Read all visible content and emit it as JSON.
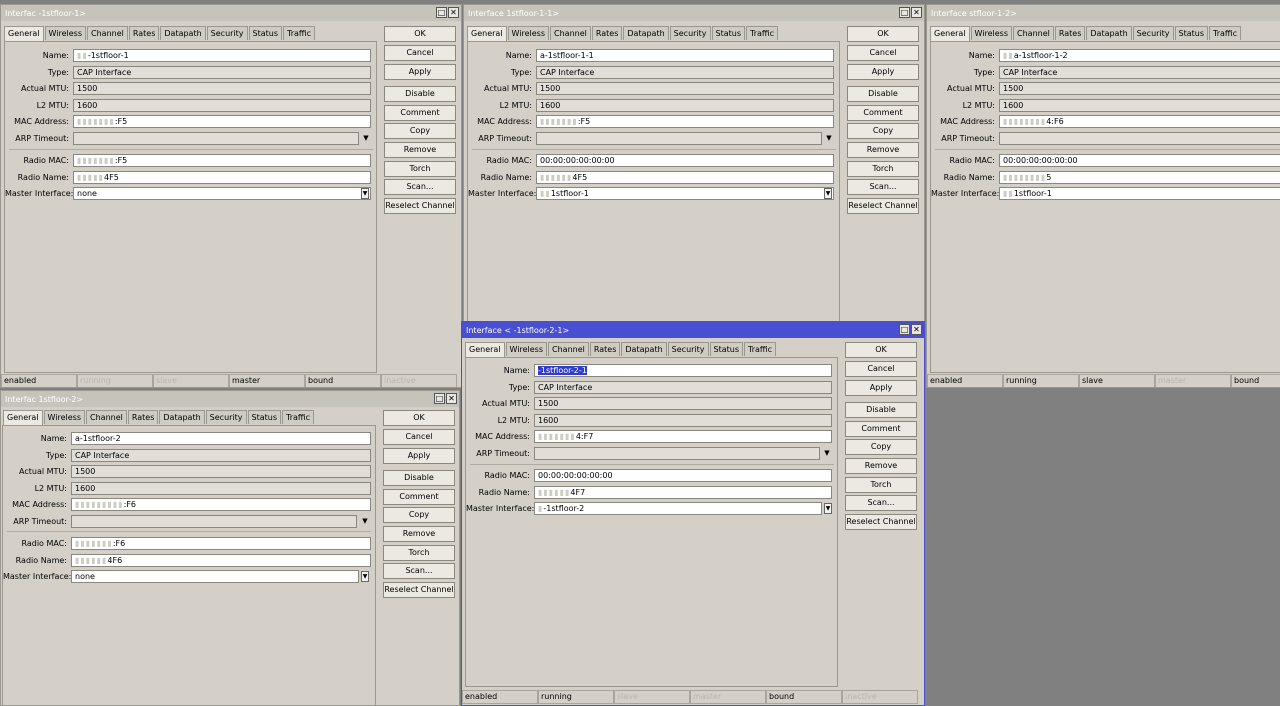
{
  "tabs": [
    "General",
    "Wireless",
    "Channel",
    "Rates",
    "Datapath",
    "Security",
    "Status",
    "Traffic"
  ],
  "buttons": [
    "OK",
    "Cancel",
    "Apply",
    "Disable",
    "Comment",
    "Copy",
    "Remove",
    "Torch",
    "Scan...",
    "Reselect Channel"
  ],
  "status_cells": [
    "enabled",
    "running",
    "slave",
    "master",
    "bound",
    "inactive"
  ],
  "windows": {
    "w1": {
      "title": "Interfac      -1stfloor-1>",
      "labels": [
        "Name:",
        "Type:",
        "Actual MTU:",
        "L2 MTU:",
        "MAC Address:",
        "ARP Timeout:",
        "Radio MAC:",
        "Radio Name:",
        "Master Interface:"
      ],
      "name": "-1stfloor-1",
      "type": "CAP Interface",
      "actual_mtu": "1500",
      "l2_mtu": "1600",
      "mac": ":F5",
      "arp_timeout": "",
      "radio_mac": ":F5",
      "radio_name": "4F5",
      "master": "none"
    },
    "w2": {
      "title": "Interface      1stfloor-1-1>",
      "labels": [
        "Name:",
        "Type:",
        "Actual MTU:",
        "L2 MTU:",
        "MAC Address:",
        "ARP Timeout:",
        "Radio MAC:",
        "Radio Name:",
        "Master Interface:"
      ],
      "name": "a-1stfloor-1-1",
      "type": "CAP Interface",
      "actual_mtu": "1500",
      "l2_mtu": "1600",
      "mac": ":F5",
      "arp_timeout": "",
      "radio_mac": "00:00:00:00:00:00",
      "radio_name": "4F5",
      "master": "1stfloor-1"
    },
    "w3": {
      "title": "Interface      stfloor-1-2>",
      "labels": [
        "Name:",
        "Type:",
        "Actual MTU:",
        "L2 MTU:",
        "MAC Address:",
        "ARP Timeout:",
        "Radio MAC:",
        "Radio Name:",
        "Master Interface:"
      ],
      "name": "a-1stfloor-1-2",
      "type": "CAP Interface",
      "actual_mtu": "1500",
      "l2_mtu": "1600",
      "mac": "4:F6",
      "arp_timeout": "",
      "radio_mac": "00:00:00:00:00:00",
      "radio_name": "5",
      "master": "1stfloor-1"
    },
    "w4": {
      "title": "Interface <      -1stfloor-2-1>",
      "labels": [
        "Name:",
        "Type:",
        "Actual MTU:",
        "L2 MTU:",
        "MAC Address:",
        "ARP Timeout:",
        "Radio MAC:",
        "Radio Name:",
        "Master Interface:"
      ],
      "name": "-1stfloor-2-1",
      "type": "CAP Interface",
      "actual_mtu": "1500",
      "l2_mtu": "1600",
      "mac": "4:F7",
      "arp_timeout": "",
      "radio_mac": "00:00:00:00:00:00",
      "radio_name": "4F7",
      "master": "-1stfloor-2"
    },
    "w5": {
      "title": "Interfac      1stfloor-2>",
      "labels": [
        "Name:",
        "Type:",
        "Actual MTU:",
        "L2 MTU:",
        "MAC Address:",
        "ARP Timeout:",
        "Radio MAC:",
        "Radio Name:",
        "Master Interface:"
      ],
      "name": "a-1stfloor-2",
      "type": "CAP Interface",
      "actual_mtu": "1500",
      "l2_mtu": "1600",
      "mac": ":F6",
      "arp_timeout": "",
      "radio_mac": ":F6",
      "radio_name": "4F6",
      "master": "none"
    }
  }
}
